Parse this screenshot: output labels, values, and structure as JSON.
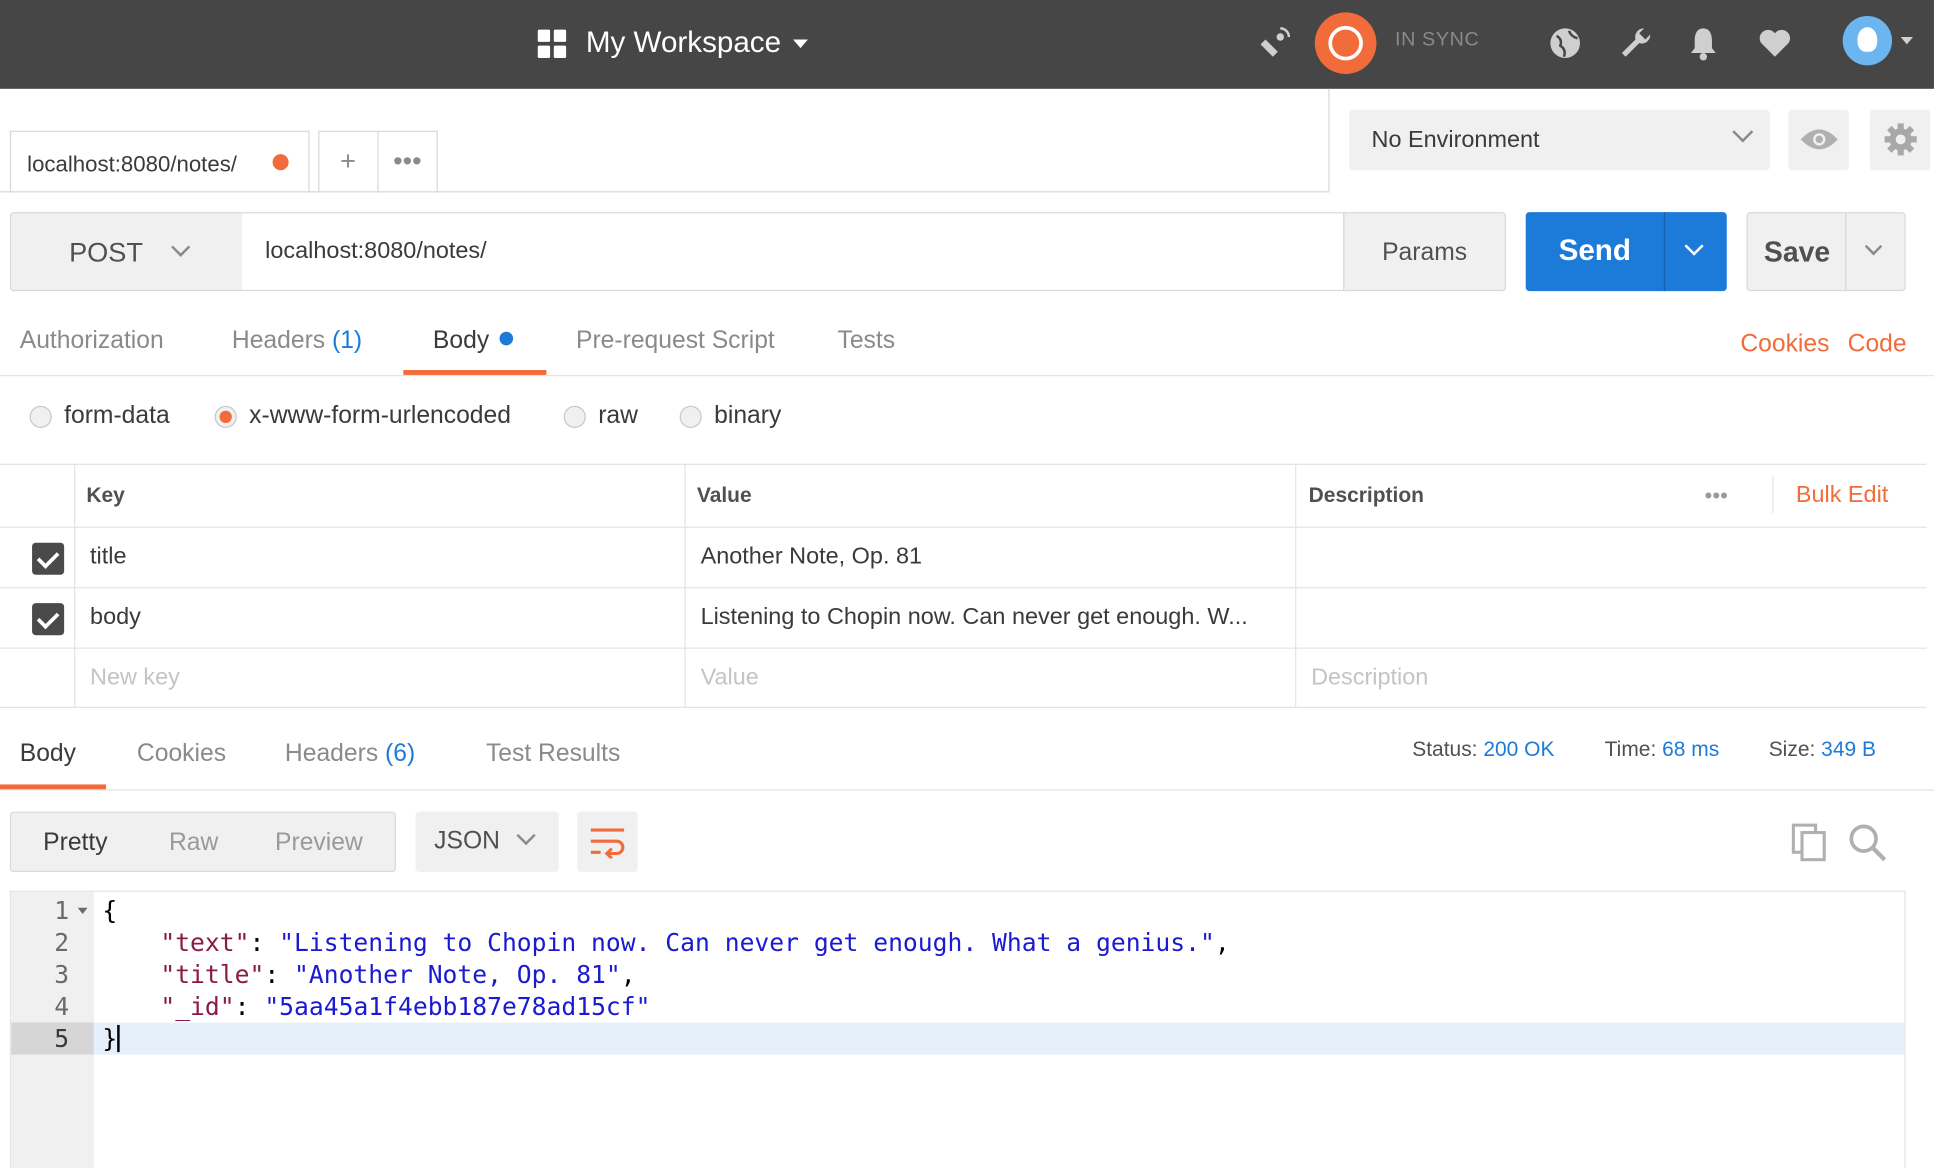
{
  "topbar": {
    "workspace": "My Workspace",
    "sync_status": "IN SYNC",
    "icons": [
      "satellite-icon",
      "sync-icon",
      "globe-icon",
      "wrench-icon",
      "bell-icon",
      "heart-icon",
      "avatar-icon"
    ]
  },
  "tabs": {
    "active": "localhost:8080/notes/",
    "new_tab": "+",
    "more": "•••"
  },
  "environment": {
    "selected": "No Environment"
  },
  "request": {
    "method": "POST",
    "url": "localhost:8080/notes/",
    "params_label": "Params",
    "send_label": "Send",
    "save_label": "Save"
  },
  "request_tabs": {
    "authorization": "Authorization",
    "headers": "Headers",
    "headers_count": "(1)",
    "body": "Body",
    "prerequest": "Pre-request Script",
    "tests": "Tests",
    "cookies": "Cookies",
    "code": "Code"
  },
  "body_modes": {
    "form_data": "form-data",
    "urlencoded": "x-www-form-urlencoded",
    "raw": "raw",
    "binary": "binary",
    "selected": "x-www-form-urlencoded"
  },
  "kv_table": {
    "headers": {
      "key": "Key",
      "value": "Value",
      "description": "Description",
      "more": "•••",
      "bulk_edit": "Bulk Edit"
    },
    "rows": [
      {
        "key": "title",
        "value": "Another Note, Op. 81",
        "checked": true
      },
      {
        "key": "body",
        "value": "Listening to Chopin now. Can never get enough. W...",
        "checked": true
      }
    ],
    "placeholders": {
      "key": "New key",
      "value": "Value",
      "description": "Description"
    }
  },
  "response_tabs": {
    "body": "Body",
    "cookies": "Cookies",
    "headers": "Headers",
    "headers_count": "(6)",
    "test_results": "Test Results"
  },
  "response_stats": {
    "status_label": "Status:",
    "status_value": "200 OK",
    "time_label": "Time:",
    "time_value": "68 ms",
    "size_label": "Size:",
    "size_value": "349 B"
  },
  "viewer": {
    "pretty": "Pretty",
    "raw": "Raw",
    "preview": "Preview",
    "format": "JSON"
  },
  "code_lines": {
    "n1": "1",
    "n2": "2",
    "n3": "3",
    "n4": "4",
    "n5": "5",
    "open_brace": "{",
    "close_brace": "}",
    "text_key": "\"text\"",
    "text_val": "\"Listening to Chopin now. Can never get enough. What a genius.\"",
    "title_key": "\"title\"",
    "title_val": "\"Another Note, Op. 81\"",
    "id_key": "\"_id\"",
    "id_val": "\"5aa45a1f4ebb187e78ad15cf\""
  },
  "colors": {
    "topbar": "#464646",
    "accent_orange": "#f26b3a",
    "accent_blue": "#1c7ad9"
  }
}
